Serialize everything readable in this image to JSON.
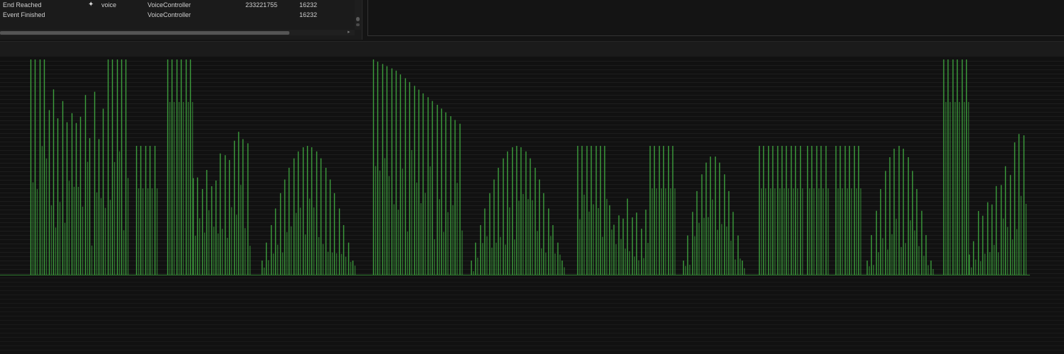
{
  "event_log": {
    "rows": [
      {
        "event": "End Reached",
        "icon": "speaker-icon",
        "icon_glyph": "✦",
        "name": "voice",
        "owner": "VoiceController",
        "id": "233221755",
        "count": "16232"
      },
      {
        "event": "Event Finished",
        "icon": "",
        "icon_glyph": "",
        "name": "",
        "owner": "VoiceController",
        "id": "",
        "count": "16232"
      }
    ]
  },
  "colors": {
    "waveform": "#3fa83f",
    "background": "#111111",
    "panel": "#1b1b1b"
  }
}
